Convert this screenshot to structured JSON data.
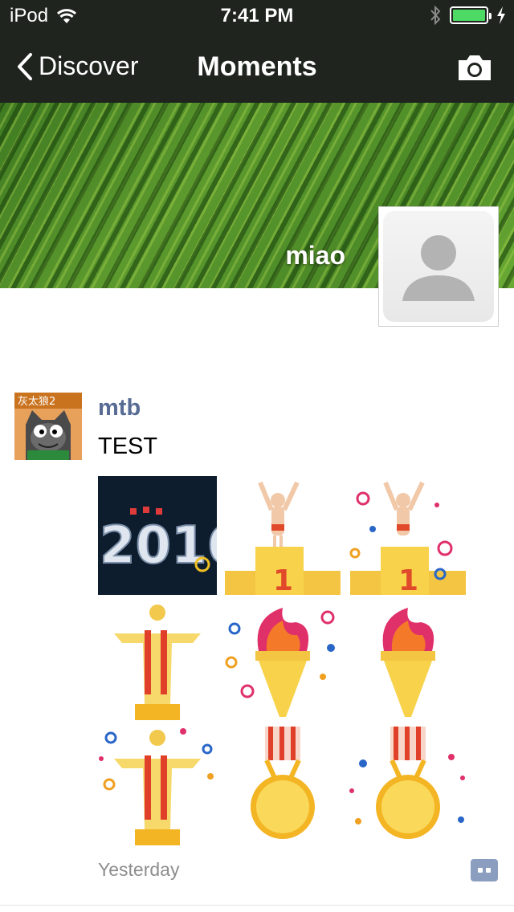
{
  "status_bar": {
    "carrier": "iPod",
    "time": "7:41 PM",
    "battery_level": 1.0,
    "battery_color": "#4cd964"
  },
  "nav": {
    "back_label": "Discover",
    "title": "Moments"
  },
  "cover": {
    "username": "miao"
  },
  "post": {
    "user": "mtb",
    "avatar_text": "灰太狼2",
    "text": "TEST",
    "time": "Yesterday",
    "link_color": "#576b95",
    "images": [
      "2016-banner",
      "podium",
      "podium-confetti",
      "christ-statue",
      "torch-confetti",
      "torch",
      "christ-statue-confetti",
      "medal",
      "medal-confetti"
    ]
  }
}
